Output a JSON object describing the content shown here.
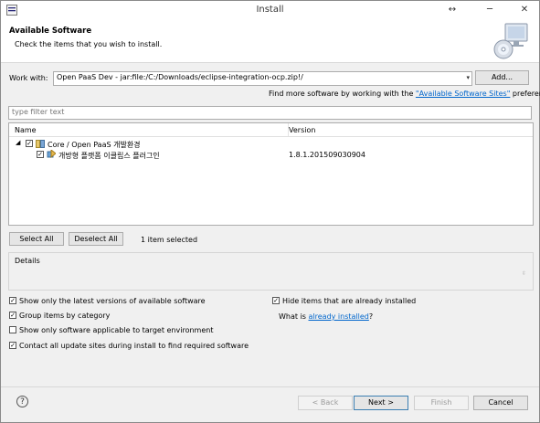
{
  "window": {
    "title": "Install",
    "buttons": {
      "restore": "↔",
      "minimize": "─",
      "close": "✕"
    }
  },
  "header": {
    "title": "Available Software",
    "subtitle": "Check the items that you wish to install."
  },
  "work_with": {
    "label": "Work with:",
    "value": "Open PaaS Dev - jar:file:/C:/Downloads/eclipse-integration-ocp.zip!/",
    "add_label": "Add..."
  },
  "more_software": {
    "prefix": "Find more software by working with the ",
    "link": "\"Available Software Sites\"",
    "suffix": " preferences."
  },
  "filter": {
    "placeholder": "type filter text"
  },
  "tree": {
    "columns": [
      "Name",
      "Version"
    ],
    "rows": [
      {
        "name": "Core / Open PaaS 개발환경",
        "version": "",
        "expanded": true,
        "checked": true
      },
      {
        "name": "개방형 플랫폼 이클립스 플러그인",
        "version": "1.8.1.201509030904",
        "checked": true
      }
    ]
  },
  "selection": {
    "select_all": "Select All",
    "deselect_all": "Deselect All",
    "status": "1 item selected"
  },
  "details": {
    "label": "Details"
  },
  "options": {
    "latest_versions": {
      "label": "Show only the latest versions of available software",
      "checked": true
    },
    "hide_installed": {
      "label": "Hide items that are already installed",
      "checked": true
    },
    "group_by_category": {
      "label": "Group items by category",
      "checked": true
    },
    "already_installed_prefix": "What is ",
    "already_installed_link": "already installed",
    "already_installed_suffix": "?",
    "target_env": {
      "label": "Show only software applicable to target environment",
      "checked": false
    },
    "contact_sites": {
      "label": "Contact all update sites during install to find required software",
      "checked": true
    }
  },
  "footer": {
    "back": "< Back",
    "next": "Next >",
    "finish": "Finish",
    "cancel": "Cancel",
    "help": "?"
  },
  "colors": {
    "link": "#0066cc",
    "default_button_border": "#3c7fb1"
  }
}
